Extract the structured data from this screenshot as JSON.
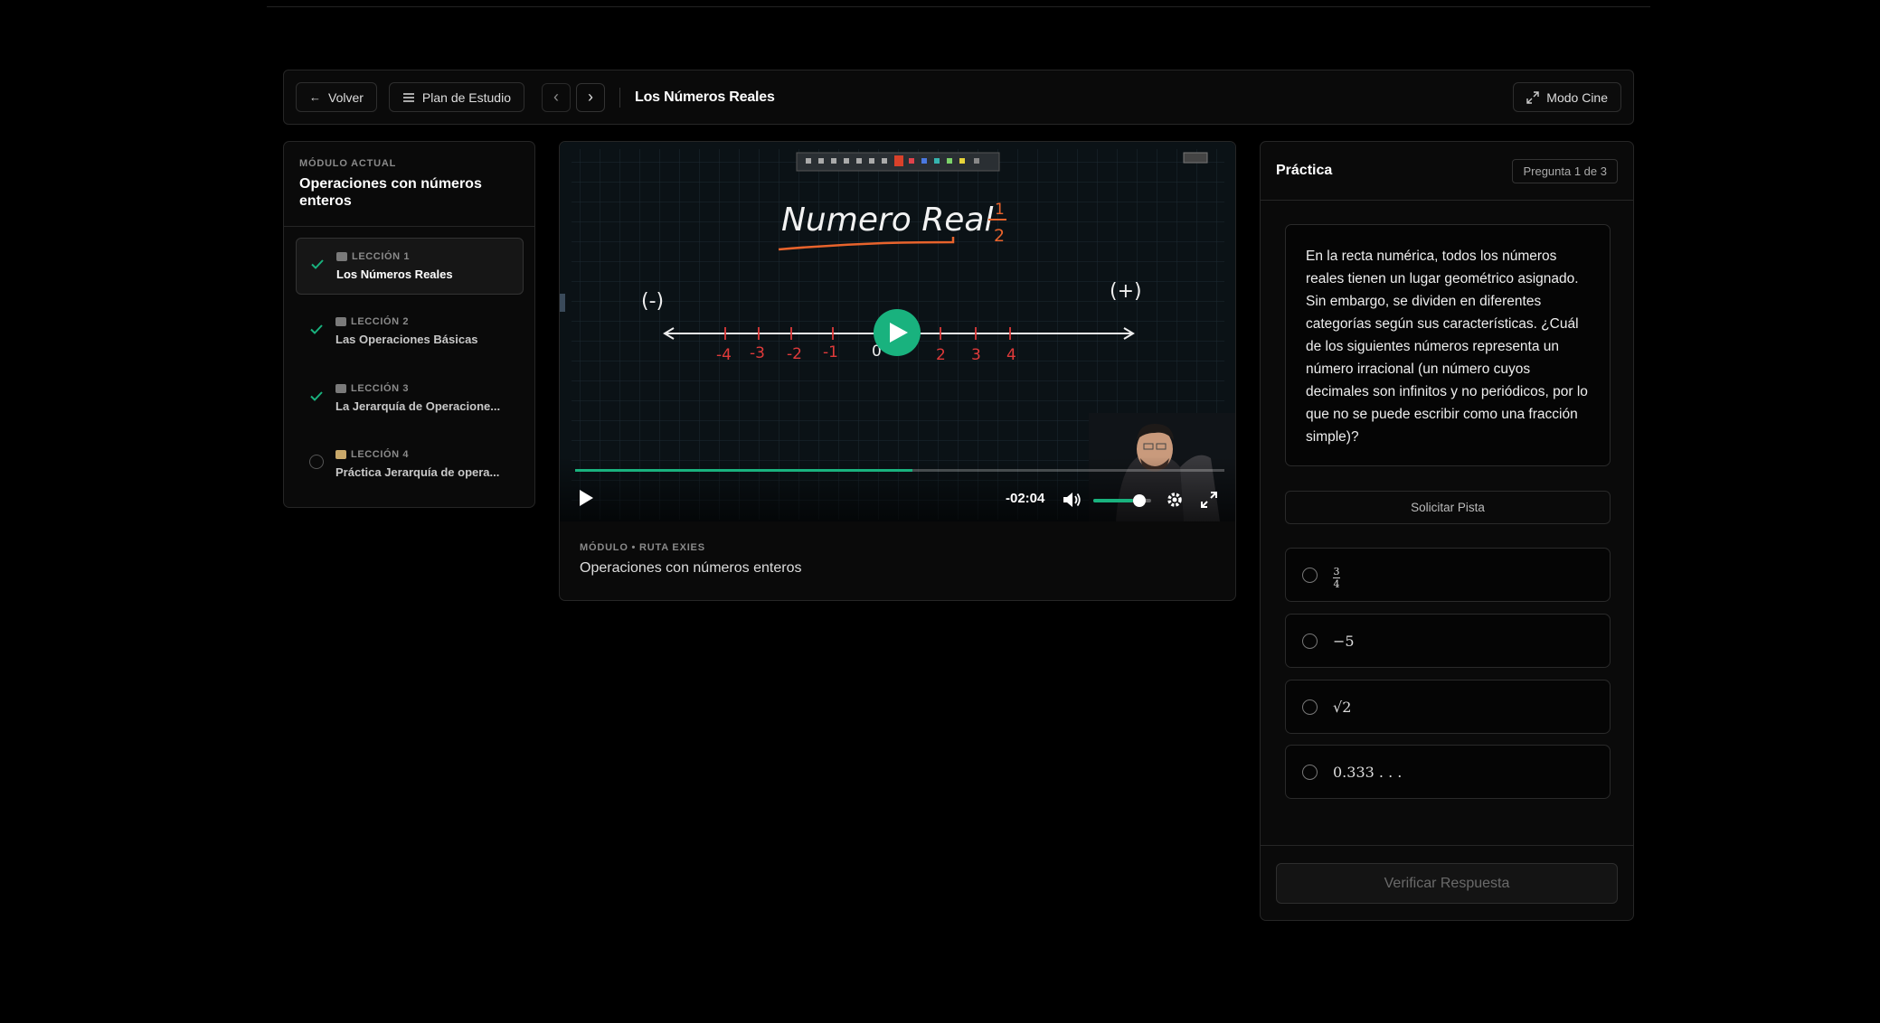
{
  "topbar": {
    "back_label": "Volver",
    "plan_label": "Plan de Estudio",
    "lesson_title": "Los Números Reales",
    "cinema_label": "Modo Cine"
  },
  "sidebar": {
    "kicker": "MÓDULO ACTUAL",
    "module_title": "Operaciones con números enteros",
    "lessons": [
      {
        "number": "LECCIÓN 1",
        "title": "Los Números Reales",
        "status": "completed",
        "icon": "video-icon"
      },
      {
        "number": "LECCIÓN 2",
        "title": "Las Operaciones Básicas",
        "status": "completed",
        "icon": "video-icon"
      },
      {
        "number": "LECCIÓN 3",
        "title": "La Jerarquía de Operacione...",
        "status": "completed",
        "icon": "video-icon"
      },
      {
        "number": "LECCIÓN 4",
        "title": "Práctica Jerarquía de opera...",
        "status": "pending",
        "icon": "memo-icon"
      }
    ]
  },
  "video": {
    "board_title": "Numero Real",
    "board_fraction_top": "1",
    "board_fraction_bottom": "2",
    "neg_sign": "(-)",
    "pos_sign": "(+)",
    "ticks": [
      "-4",
      "-3",
      "-2",
      "-1",
      "0",
      "2",
      "3",
      "4"
    ],
    "time_remaining": "-02:04",
    "progress": 0.52,
    "volume": 0.68,
    "accent": "#19b27e"
  },
  "video_meta": {
    "kicker": "MÓDULO • RUTA EXIES",
    "title": "Operaciones con números enteros"
  },
  "practice": {
    "title": "Práctica",
    "counter": "Pregunta 1 de 3",
    "question": "En la recta numérica, todos los números reales tienen un lugar geométrico asignado. Sin embargo, se dividen en diferentes categorías según sus características. ¿Cuál de los siguientes números representa un número irracional (un número cuyos decimales son infinitos y no periódicos, por lo que no se puede escribir como una fracción simple)?",
    "hint_label": "Solicitar Pista",
    "options": [
      {
        "num": "3",
        "den": "4"
      },
      {
        "text": "−5"
      },
      {
        "text": "√2"
      },
      {
        "text": "0.333 . . ."
      }
    ],
    "verify_label": "Verificar Respuesta"
  }
}
